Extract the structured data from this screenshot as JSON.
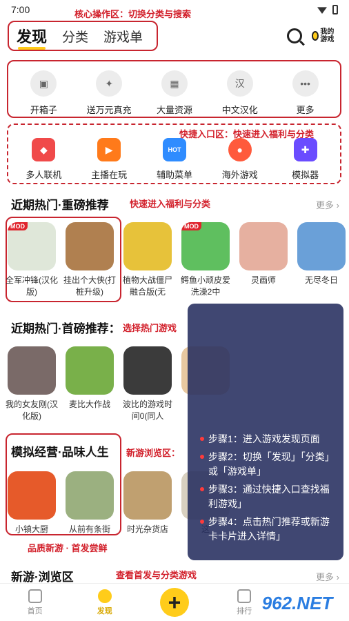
{
  "status": {
    "time": "7:00"
  },
  "annotations": {
    "core": "核心操作区：切换分类与搜索",
    "quick": "快捷入口区：快速进入福利与分类",
    "hot_arrow": "快速进入福利与分类",
    "select_hot": "选择热门游戏",
    "new_area": "新游浏览区：",
    "quality": "品质新游 · 首发尝鲜",
    "view_first": "查看首发与分类游戏"
  },
  "header": {
    "tabs": [
      "发现",
      "分类",
      "游戏单"
    ],
    "my_games": "我的游戏"
  },
  "quick_row1": [
    {
      "label": "开箱子",
      "icon": "box-icon"
    },
    {
      "label": "送万元真充",
      "icon": "gift-icon"
    },
    {
      "label": "大量资源",
      "icon": "grid-icon"
    },
    {
      "label": "中文汉化",
      "icon": "han-icon"
    },
    {
      "label": "更多",
      "icon": "more-icon"
    }
  ],
  "quick_row2": [
    {
      "label": "多人联机",
      "icon": "bag-icon",
      "color": "#f04a4a"
    },
    {
      "label": "主播在玩",
      "icon": "tv-icon",
      "color": "#ff7a1a"
    },
    {
      "label": "辅助菜单",
      "icon": "hot-fire-icon",
      "color": "#2f8cff"
    },
    {
      "label": "海外游戏",
      "icon": "planet-icon",
      "color": "#ff5a3c"
    },
    {
      "label": "模拟器",
      "icon": "gamepad-icon",
      "color": "#6a4cff"
    }
  ],
  "section1": {
    "title": "近期热门·重磅推荐",
    "more": "更多",
    "games": [
      {
        "name": "全军冲锋(汉化版)",
        "tag": "MOD",
        "color": "#dfe7d9"
      },
      {
        "name": "挂出个大侠(打桩升级)",
        "tag": "",
        "color": "#b08050"
      },
      {
        "name": "植物大战僵尸融合版(无",
        "tag": "",
        "color": "#e7c23a"
      },
      {
        "name": "鳄鱼小顽皮爱洗澡2中",
        "tag": "MOD",
        "color": "#5fbf5f"
      },
      {
        "name": "灵画师",
        "tag": "",
        "color": "#e6b0a0"
      },
      {
        "name": "无尽冬日",
        "tag": "",
        "color": "#6aa0d8"
      }
    ]
  },
  "section2": {
    "title": "近期热门·首磅推荐：",
    "games": [
      {
        "name": "我的女友刚(汉化版)",
        "color": "#7a6a68"
      },
      {
        "name": "麦比大作战",
        "color": "#79b04a"
      },
      {
        "name": "波比的游戏时间0(同人",
        "color": "#3b3b3b"
      },
      {
        "name": "",
        "color": "#e8c8a0"
      }
    ]
  },
  "section3": {
    "title": "模拟经营·品味人生",
    "games": [
      {
        "name": "小镇大厨",
        "color": "#e65a2a"
      },
      {
        "name": "从前有条街",
        "color": "#9bb080"
      },
      {
        "name": "时光杂货店",
        "color": "#c0a070"
      },
      {
        "name": "这",
        "color": "#d8d0c0"
      }
    ]
  },
  "section4": {
    "title": "新游·浏览区",
    "more": "更多"
  },
  "steps": [
    "步骤1：进入游戏发现页面",
    "步骤2：切换「发现」「分类」或「游戏单」",
    "步骤3：通过快捷入口查找福利游戏」",
    "步骤4：点击热门推荐或新游卡卡片进入详情」"
  ],
  "nav": {
    "items": [
      "首页",
      "发现",
      "",
      "排行"
    ],
    "plus": "+"
  },
  "watermark": "962.NET"
}
